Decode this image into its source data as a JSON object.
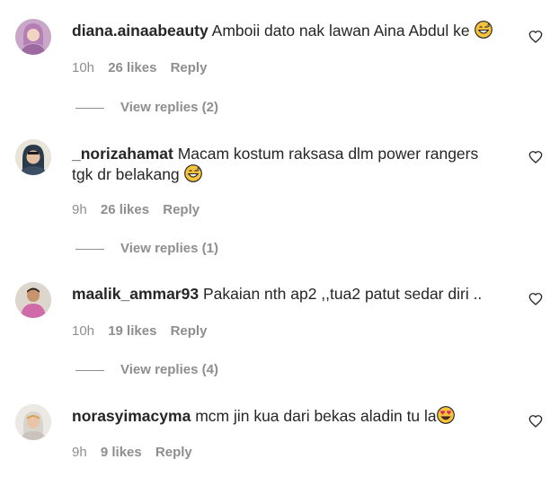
{
  "comments": [
    {
      "username": "diana.ainaabeauty",
      "text": "Amboii dato nak lawan Aina Abdul ke",
      "emoji": "grinning-sweat-emoji",
      "time": "10h",
      "likes": "26 likes",
      "reply": "Reply",
      "view_replies": "View replies (2)"
    },
    {
      "username": "_norizahamat",
      "text": "Macam kostum raksasa dlm power rangers tgk dr belakang",
      "emoji": "grinning-sweat-emoji",
      "time": "9h",
      "likes": "26 likes",
      "reply": "Reply",
      "view_replies": "View replies (1)"
    },
    {
      "username": "maalik_ammar93",
      "text": "Pakaian nth ap2 ,,tua2 patut sedar diri ..",
      "time": "10h",
      "likes": "19 likes",
      "reply": "Reply",
      "view_replies": "View replies (4)"
    },
    {
      "username": "norasyimacyma",
      "text": "mcm jin kua dari bekas aladin tu la",
      "emoji": "heart-eyes-emoji",
      "time": "9h",
      "likes": "9 likes",
      "reply": "Reply"
    }
  ],
  "icons": {
    "like": "heart-outline-icon"
  },
  "colors": {
    "text": "#262626",
    "secondary": "#8e8e8e",
    "background": "#ffffff"
  }
}
